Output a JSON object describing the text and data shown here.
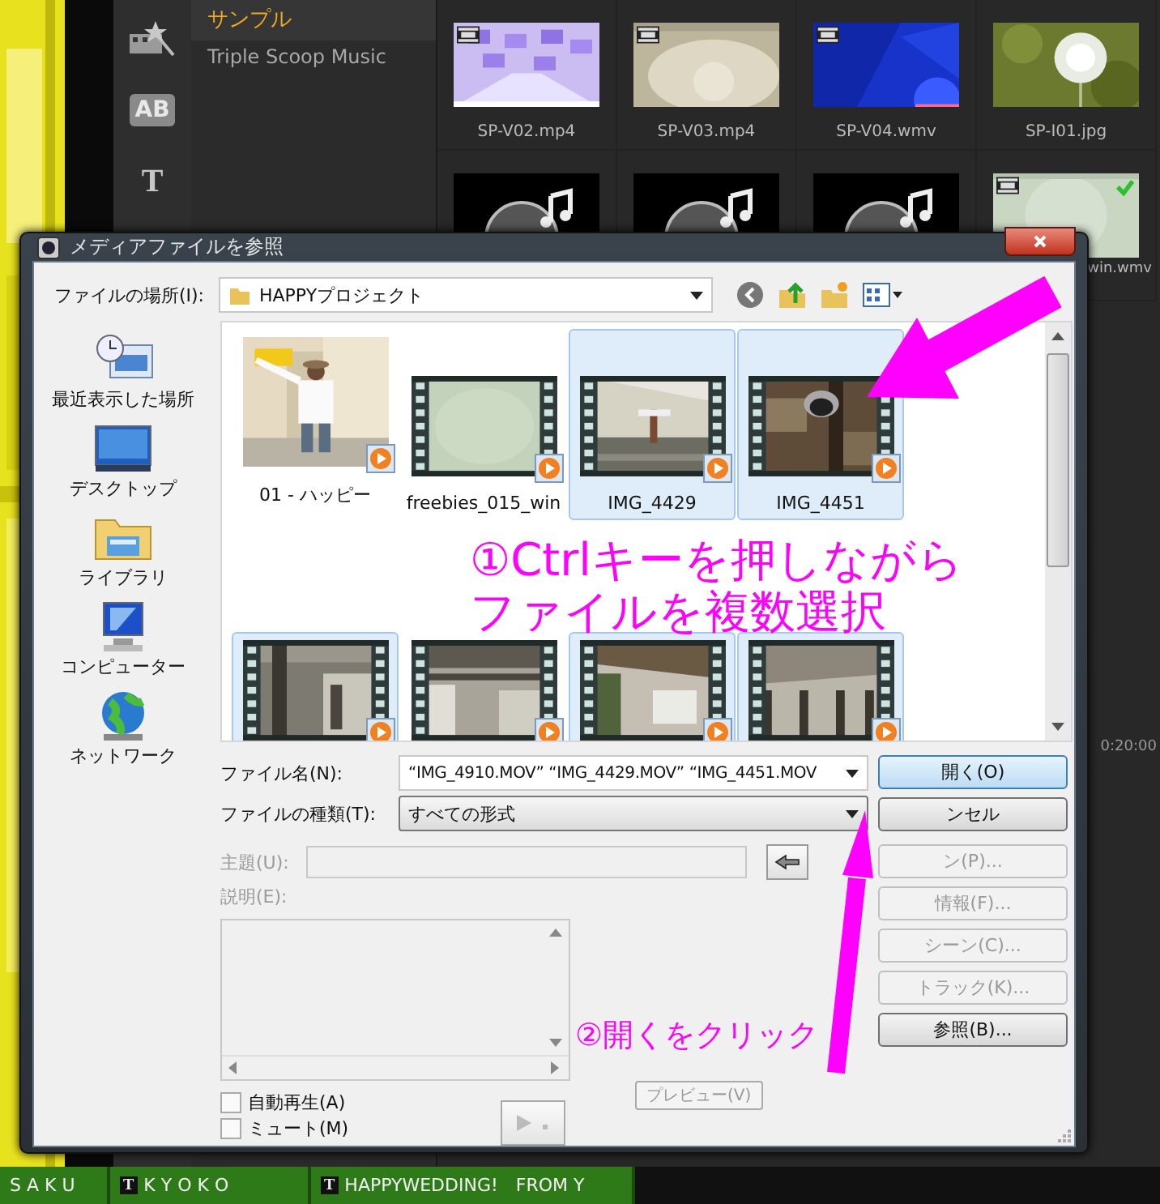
{
  "app": {
    "tool_icons": [
      {
        "kind": "effects"
      },
      {
        "kind": "glyph",
        "glyph": "AB"
      },
      {
        "kind": "glyph",
        "glyph": "T"
      }
    ],
    "sidebar": [
      {
        "label": "サンプル",
        "selected": true
      },
      {
        "label": "Triple Scoop Music",
        "selected": false
      }
    ],
    "media": [
      {
        "name": "SP-V02.mp4",
        "kind": "video",
        "checked": false
      },
      {
        "name": "SP-V03.mp4",
        "kind": "video",
        "checked": false
      },
      {
        "name": "SP-V04.wmv",
        "kind": "video",
        "checked": false
      },
      {
        "name": "SP-I01.jpg",
        "checked": false
      },
      {
        "kind": "audio",
        "checked": false
      },
      {
        "kind": "audio",
        "checked": false
      },
      {
        "kind": "audio",
        "checked": false
      },
      {
        "name": "win.wmv",
        "kind": "video",
        "checked": true
      }
    ],
    "timecode": "0:20:00",
    "timeline_clips": [
      {
        "label": "S A K U"
      },
      {
        "label": "K Y O K O",
        "icon": "T"
      },
      {
        "label": "HAPPYWEDDING!　FROM Y",
        "icon": "T"
      }
    ]
  },
  "dialog": {
    "title": "メディアファイルを参照",
    "location_label": "ファイルの場所(I):",
    "location": "HAPPYプロジェクト",
    "places": [
      {
        "label": "最近表示した場所",
        "kind": "recent"
      },
      {
        "label": "デスクトップ",
        "kind": "desktop"
      },
      {
        "label": "ライブラリ",
        "kind": "library"
      },
      {
        "label": "コンピューター",
        "kind": "computer"
      },
      {
        "label": "ネットワーク",
        "kind": "network"
      }
    ],
    "files": [
      {
        "name": "01 - ハッピー",
        "selected": false
      },
      {
        "name": "freebies_015_win",
        "kind": "film",
        "selected": false
      },
      {
        "name": "IMG_4429",
        "kind": "film",
        "selected": true
      },
      {
        "name": "IMG_4451",
        "kind": "film",
        "selected": true
      },
      {
        "kind": "film",
        "selected": true
      },
      {
        "kind": "film",
        "selected": false
      },
      {
        "kind": "film",
        "selected": true
      },
      {
        "kind": "film",
        "selected": true
      }
    ],
    "filename_label": "ファイル名(N):",
    "filename": "“IMG_4910.MOV” “IMG_4429.MOV” “IMG_4451.MOV",
    "type_label": "ファイルの種類(T):",
    "type": "すべての形式",
    "subject_label": "主題(U):",
    "description_label": "説明(E):",
    "info_disabled": true,
    "buttons": [
      {
        "label": "開く(O)",
        "disabled": false,
        "default": true
      },
      {
        "label": "ンセル",
        "disabled": false,
        "default": false
      },
      {
        "label": "ン(P)...",
        "disabled": true,
        "default": false
      },
      {
        "label": "情報(F)...",
        "disabled": true,
        "default": false
      },
      {
        "label": "シーン(C)...",
        "disabled": true,
        "default": false
      },
      {
        "label": "トラック(K)...",
        "disabled": true,
        "default": false
      },
      {
        "label": "参照(B)...",
        "disabled": false,
        "default": false
      }
    ],
    "checkboxes": [
      {
        "label": "自動再生(A)",
        "checked": false
      },
      {
        "label": "ミュート(M)",
        "checked": false
      }
    ],
    "preview_label": "プレビュー(V)",
    "preview_disabled": true
  },
  "annotations": [
    {
      "lines": [
        "①Ctrlキーを押しながら",
        "ファイルを複数選択"
      ]
    },
    {
      "lines": [
        "②開くをクリック"
      ]
    }
  ]
}
